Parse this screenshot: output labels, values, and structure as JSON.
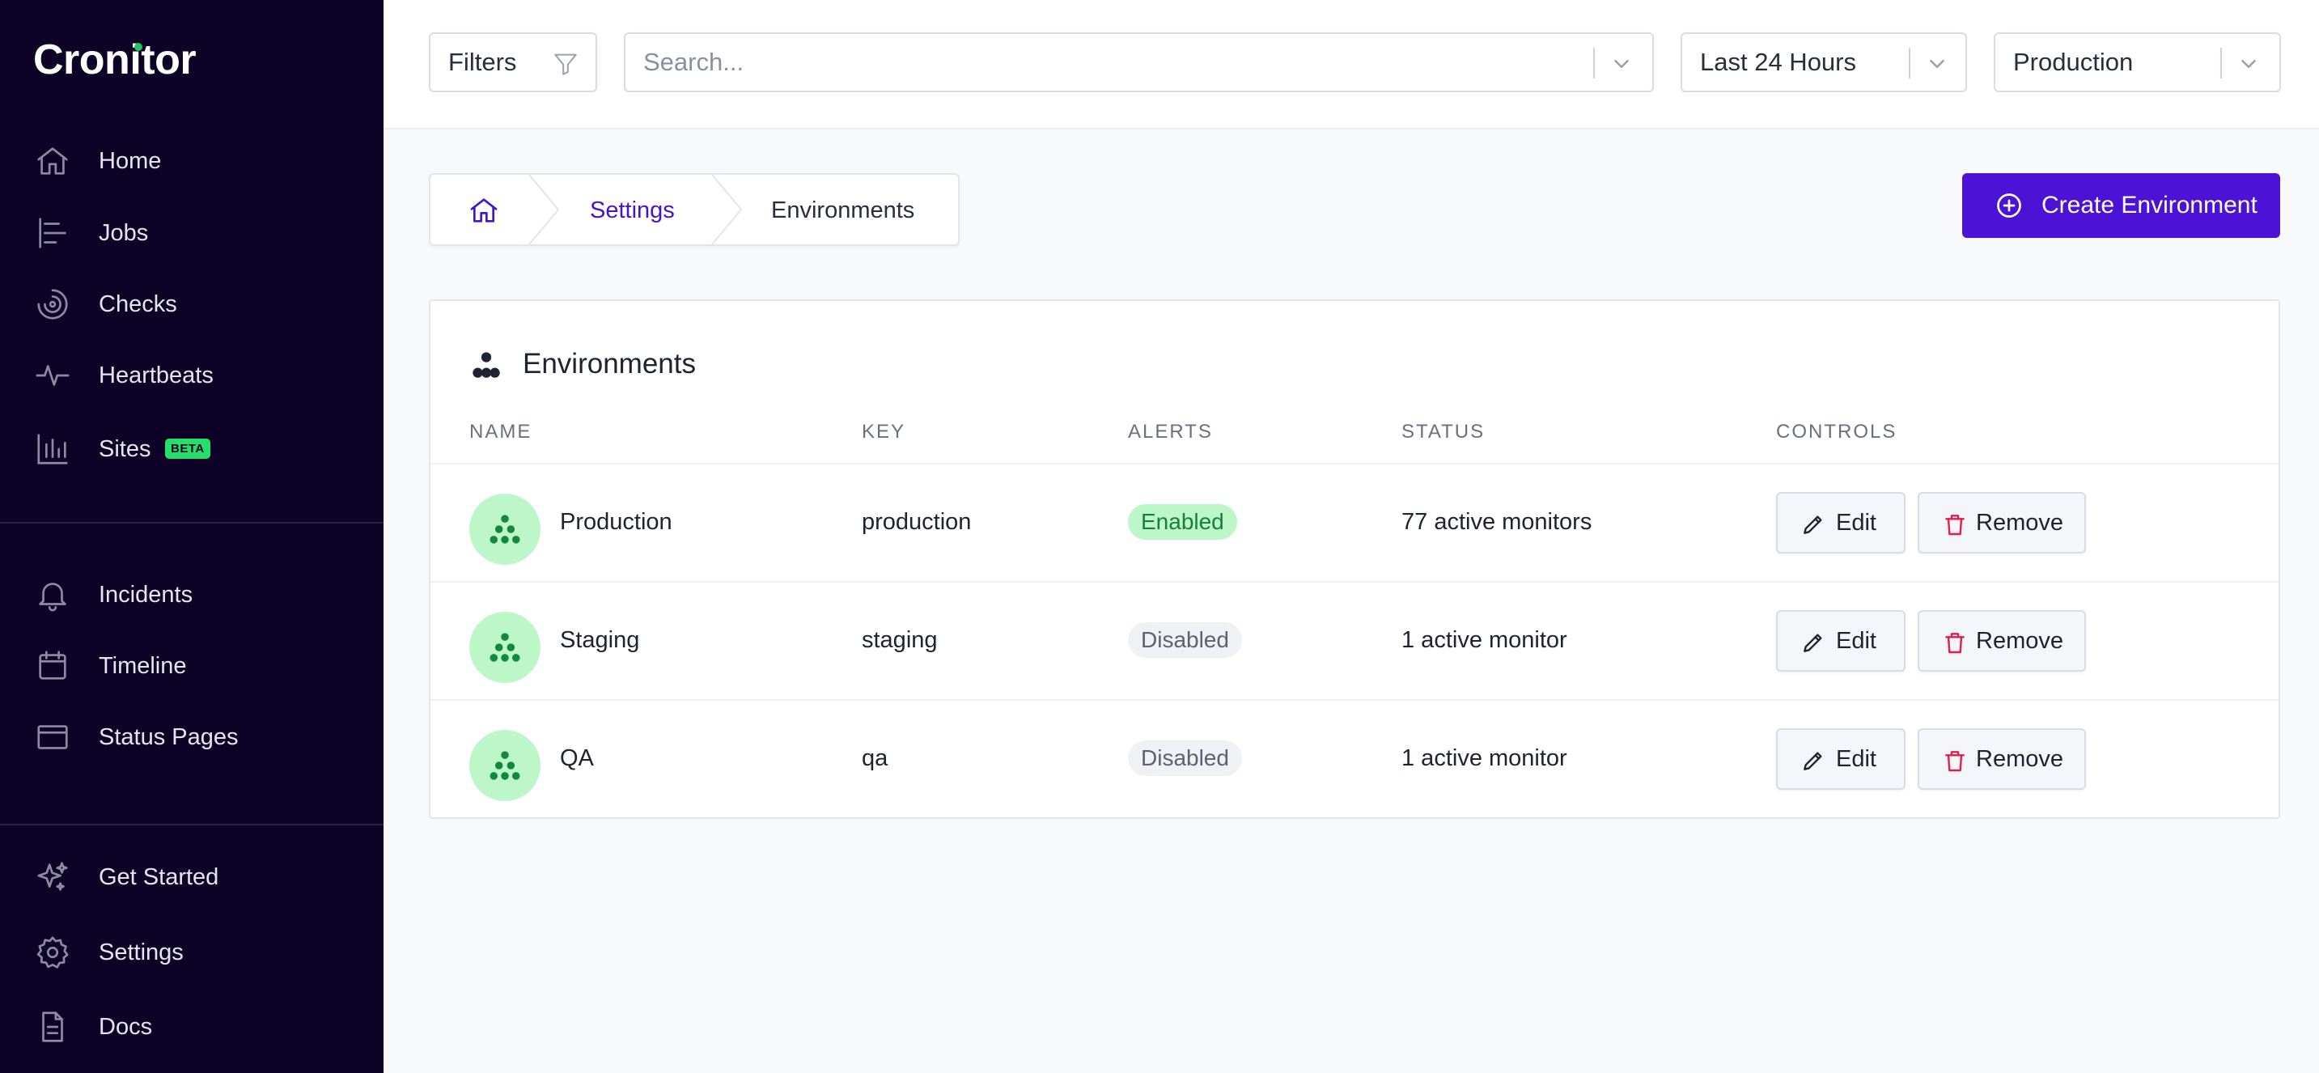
{
  "app": {
    "brand": "Cronitor"
  },
  "sidebar": {
    "primary": [
      {
        "label": "Home",
        "icon": "home-icon"
      },
      {
        "label": "Jobs",
        "icon": "jobs-icon"
      },
      {
        "label": "Checks",
        "icon": "checks-icon"
      },
      {
        "label": "Heartbeats",
        "icon": "heartbeat-icon"
      },
      {
        "label": "Sites",
        "icon": "bar-chart-icon",
        "badge": "BETA"
      }
    ],
    "secondary": [
      {
        "label": "Incidents",
        "icon": "bell-icon"
      },
      {
        "label": "Timeline",
        "icon": "calendar-icon"
      },
      {
        "label": "Status Pages",
        "icon": "browser-window-icon"
      }
    ],
    "footer": [
      {
        "label": "Get Started",
        "icon": "sparkles-icon"
      },
      {
        "label": "Settings",
        "icon": "gear-icon"
      },
      {
        "label": "Docs",
        "icon": "document-icon"
      }
    ]
  },
  "topbar": {
    "filters_label": "Filters",
    "search_placeholder": "Search...",
    "time_range": "Last 24 Hours",
    "environment": "Production"
  },
  "breadcrumb": {
    "settings": "Settings",
    "current": "Environments"
  },
  "actions": {
    "create_label": "Create Environment"
  },
  "panel": {
    "title": "Environments",
    "columns": [
      "NAME",
      "KEY",
      "ALERTS",
      "STATUS",
      "CONTROLS"
    ],
    "rows": [
      {
        "name": "Production",
        "key": "production",
        "alerts": "Enabled",
        "alerts_on": true,
        "status": "77 active monitors"
      },
      {
        "name": "Staging",
        "key": "staging",
        "alerts": "Disabled",
        "alerts_on": false,
        "status": "1 active monitor"
      },
      {
        "name": "QA",
        "key": "qa",
        "alerts": "Disabled",
        "alerts_on": false,
        "status": "1 active monitor"
      }
    ],
    "edit_label": "Edit",
    "remove_label": "Remove"
  },
  "colors": {
    "accent": "#4c12d6",
    "sidebar_bg": "#0c0326",
    "success_bg": "#bdf7c9",
    "success_text": "#16803b",
    "danger": "#e11d48"
  }
}
